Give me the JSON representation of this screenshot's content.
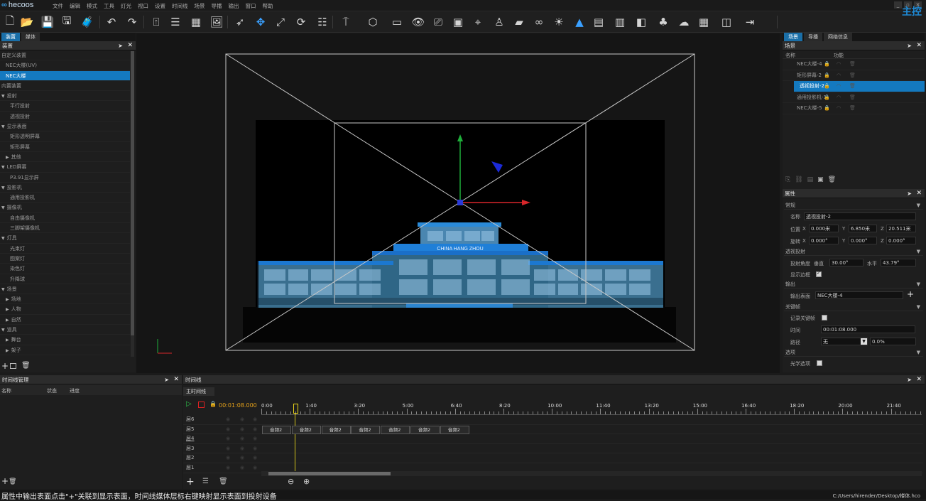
{
  "app": {
    "logo": "hecoos",
    "brand": "主控"
  },
  "menu": [
    "文件",
    "编辑",
    "模式",
    "工具",
    "灯光",
    "视口",
    "设置",
    "时间线",
    "场景",
    "导播",
    "输出",
    "窗口",
    "帮助"
  ],
  "window_controls": [
    "_",
    "▫",
    "✕"
  ],
  "toolbar_icons": [
    "file-new-icon",
    "folder-open-icon",
    "save-icon",
    "save-as-icon",
    "package-icon",
    "undo-icon",
    "redo-icon",
    "import-icon",
    "align-icon",
    "grid-icon",
    "image-icon",
    "select-icon",
    "move-icon",
    "scale-icon",
    "rotate-icon",
    "stack-icon",
    "light-icon",
    "cube-icon",
    "screen-icon",
    "eye-icon",
    "projector-icon",
    "camera-icon",
    "focus-icon",
    "person-icon",
    "ruler-icon",
    "link-icon",
    "sun-icon",
    "cone-icon",
    "led-grid-icon",
    "monitor-icon",
    "split-icon",
    "group-icon",
    "weather-icon",
    "layout-icon",
    "mirror-icon",
    "exit-icon"
  ],
  "left_panel": {
    "tabs": [
      "装置",
      "媒体"
    ],
    "title": "装置",
    "tree": [
      {
        "label": "自定义装置",
        "level": 0,
        "arrow": false,
        "sel": false
      },
      {
        "label": "NEC大楼(UV)",
        "level": 1,
        "arrow": false,
        "sel": false
      },
      {
        "label": "NEC大楼",
        "level": 1,
        "arrow": false,
        "sel": true
      },
      {
        "label": "内置装置",
        "level": 0,
        "arrow": false,
        "sel": false
      },
      {
        "label": "投射",
        "level": 0,
        "arrow": "▼",
        "sel": false
      },
      {
        "label": "平行投射",
        "level": 2,
        "arrow": false,
        "sel": false
      },
      {
        "label": "透视投射",
        "level": 2,
        "arrow": false,
        "sel": false
      },
      {
        "label": "显示表面",
        "level": 0,
        "arrow": "▼",
        "sel": false
      },
      {
        "label": "矩形透明屏幕",
        "level": 2,
        "arrow": false,
        "sel": false
      },
      {
        "label": "矩形屏幕",
        "level": 2,
        "arrow": false,
        "sel": false
      },
      {
        "label": "其他",
        "level": 1,
        "arrow": "▶",
        "sel": false
      },
      {
        "label": "LED屏幕",
        "level": 0,
        "arrow": "▼",
        "sel": false
      },
      {
        "label": "P3.91显示屏",
        "level": 2,
        "arrow": false,
        "sel": false
      },
      {
        "label": "投影机",
        "level": 0,
        "arrow": "▼",
        "sel": false
      },
      {
        "label": "通用投影机",
        "level": 2,
        "arrow": false,
        "sel": false
      },
      {
        "label": "摄像机",
        "level": 0,
        "arrow": "▼",
        "sel": false
      },
      {
        "label": "自由摄像机",
        "level": 2,
        "arrow": false,
        "sel": false
      },
      {
        "label": "三脚架摄像机",
        "level": 2,
        "arrow": false,
        "sel": false
      },
      {
        "label": "灯具",
        "level": 0,
        "arrow": "▼",
        "sel": false
      },
      {
        "label": "光束灯",
        "level": 2,
        "arrow": false,
        "sel": false
      },
      {
        "label": "图案灯",
        "level": 2,
        "arrow": false,
        "sel": false
      },
      {
        "label": "染色灯",
        "level": 2,
        "arrow": false,
        "sel": false
      },
      {
        "label": "升降球",
        "level": 2,
        "arrow": false,
        "sel": false
      },
      {
        "label": "场景",
        "level": 0,
        "arrow": "▼",
        "sel": false
      },
      {
        "label": "场地",
        "level": 1,
        "arrow": "▶",
        "sel": false
      },
      {
        "label": "人物",
        "level": 1,
        "arrow": "▶",
        "sel": false
      },
      {
        "label": "自然",
        "level": 1,
        "arrow": "▶",
        "sel": false
      },
      {
        "label": "道具",
        "level": 0,
        "arrow": "▼",
        "sel": false
      },
      {
        "label": "舞台",
        "level": 1,
        "arrow": "▶",
        "sel": false
      },
      {
        "label": "架子",
        "level": 1,
        "arrow": "▶",
        "sel": false
      }
    ]
  },
  "viewport": {
    "building_sign": "CHINA HANG ZHOU"
  },
  "scene_panel": {
    "tabs": [
      "场景",
      "导播",
      "网络信息"
    ],
    "title": "场景",
    "col_name": "名称",
    "col_func": "功能",
    "items": [
      {
        "label": "NEC大楼-4",
        "sel": false
      },
      {
        "label": "矩形屏幕-2",
        "sel": false
      },
      {
        "label": "透视投射-2",
        "sel": true
      },
      {
        "label": "通用投影机-1",
        "sel": false
      },
      {
        "label": "NEC大楼-5",
        "sel": false
      }
    ]
  },
  "props": {
    "title": "属性",
    "sec_common": "常规",
    "name_label": "名称",
    "name_value": "透视投射-2",
    "pos_label": "位置",
    "pos": [
      "0.000米",
      "6.850米",
      "20.511米"
    ],
    "rot_label": "旋转",
    "rot": [
      "0.000°",
      "0.000°",
      "0.000°"
    ],
    "axes": [
      "X",
      "Y",
      "Z"
    ],
    "sec_persp": "透视投射",
    "fov_label": "投射角度",
    "fov_v_label": "垂直",
    "fov_v": "30.00°",
    "fov_h_label": "水平",
    "fov_h": "43.79°",
    "show_edge_label": "显示边框",
    "sec_output": "输出",
    "out_surface_label": "输出表面",
    "out_surface_value": "NEC大楼-4",
    "sec_keyframe": "关键帧",
    "record_label": "记录关键帧",
    "time_label": "时间",
    "time_value": "00:01:08.000",
    "path_label": "路径",
    "path_value": "无",
    "path_pct": "0.0%",
    "sec_mat": "选项",
    "mat_label": "光学选项"
  },
  "timeline_mgr": {
    "title": "时间线管理",
    "cols": [
      "名称",
      "状态",
      "进度"
    ]
  },
  "timeline": {
    "title": "时间线",
    "tab": "主时间线",
    "current_time": "00:01:08.000",
    "ticks": [
      "0:00",
      "1:40",
      "3:20",
      "5:00",
      "6:40",
      "8:20",
      "10:00",
      "11:40",
      "13:20",
      "15:00",
      "16:40",
      "18:20",
      "20:00",
      "21:40"
    ],
    "layers": [
      "层6",
      "层5",
      "层4",
      "层3",
      "层2",
      "层1"
    ],
    "clip_label": "音频2"
  },
  "status": {
    "hint": "属性中输出表面点击\"+\"关联到显示表面，时间线媒体层标右键映射显示表面到投射设备",
    "path": "C:/Users/hirender/Desktop/楼体.hco"
  }
}
